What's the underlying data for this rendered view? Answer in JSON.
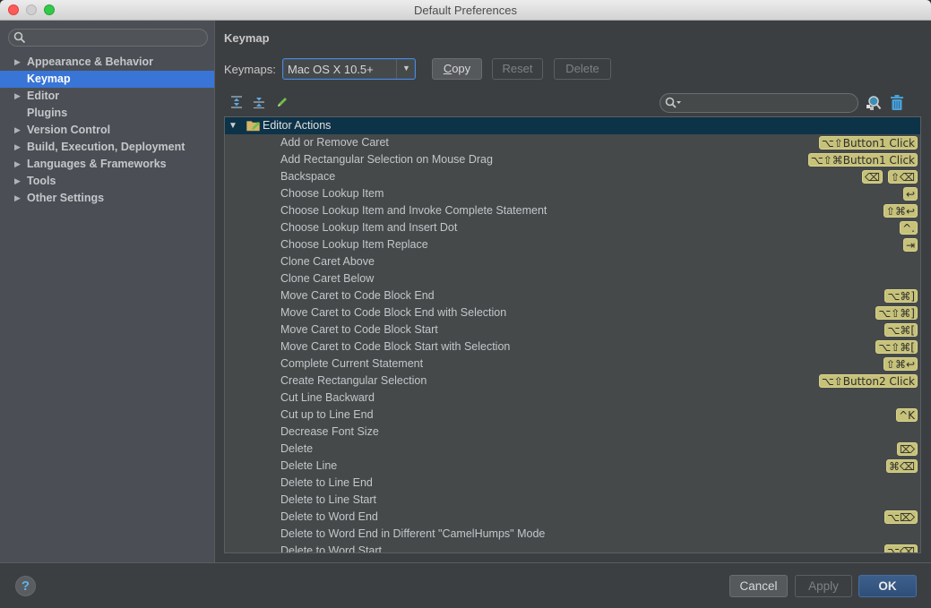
{
  "window": {
    "title": "Default Preferences"
  },
  "sidebar": {
    "search_placeholder": "",
    "items": [
      {
        "label": "Appearance & Behavior",
        "expandable": true,
        "selected": false
      },
      {
        "label": "Keymap",
        "expandable": false,
        "selected": true
      },
      {
        "label": "Editor",
        "expandable": true,
        "selected": false
      },
      {
        "label": "Plugins",
        "expandable": false,
        "selected": false
      },
      {
        "label": "Version Control",
        "expandable": true,
        "selected": false
      },
      {
        "label": "Build, Execution, Deployment",
        "expandable": true,
        "selected": false
      },
      {
        "label": "Languages & Frameworks",
        "expandable": true,
        "selected": false
      },
      {
        "label": "Tools",
        "expandable": true,
        "selected": false
      },
      {
        "label": "Other Settings",
        "expandable": true,
        "selected": false
      }
    ]
  },
  "main": {
    "heading": "Keymap",
    "keymaps_label": "Keymaps:",
    "keymap_selected": "Mac OS X 10.5+",
    "buttons": {
      "copy": "Copy",
      "reset": "Reset",
      "delete": "Delete"
    },
    "toolbar_icons": [
      "expand-all-icon",
      "collapse-all-icon",
      "edit-pencil-icon"
    ],
    "filter_value": "",
    "group": {
      "label": "Editor Actions",
      "expanded": true
    },
    "actions": [
      {
        "name": "Add or Remove Caret",
        "shortcuts": [
          "⌥⇧Button1 Click"
        ]
      },
      {
        "name": "Add Rectangular Selection on Mouse Drag",
        "shortcuts": [
          "⌥⇧⌘Button1 Click"
        ]
      },
      {
        "name": "Backspace",
        "shortcuts": [
          "⌫",
          "⇧⌫"
        ]
      },
      {
        "name": "Choose Lookup Item",
        "shortcuts": [
          "↩"
        ]
      },
      {
        "name": "Choose Lookup Item and Invoke Complete Statement",
        "shortcuts": [
          "⇧⌘↩"
        ]
      },
      {
        "name": "Choose Lookup Item and Insert Dot",
        "shortcuts": [
          "^."
        ]
      },
      {
        "name": "Choose Lookup Item Replace",
        "shortcuts": [
          "⇥"
        ]
      },
      {
        "name": "Clone Caret Above",
        "shortcuts": []
      },
      {
        "name": "Clone Caret Below",
        "shortcuts": []
      },
      {
        "name": "Move Caret to Code Block End",
        "shortcuts": [
          "⌥⌘]"
        ]
      },
      {
        "name": "Move Caret to Code Block End with Selection",
        "shortcuts": [
          "⌥⇧⌘]"
        ]
      },
      {
        "name": "Move Caret to Code Block Start",
        "shortcuts": [
          "⌥⌘["
        ]
      },
      {
        "name": "Move Caret to Code Block Start with Selection",
        "shortcuts": [
          "⌥⇧⌘["
        ]
      },
      {
        "name": "Complete Current Statement",
        "shortcuts": [
          "⇧⌘↩"
        ]
      },
      {
        "name": "Create Rectangular Selection",
        "shortcuts": [
          "⌥⇧Button2 Click"
        ]
      },
      {
        "name": "Cut Line Backward",
        "shortcuts": []
      },
      {
        "name": "Cut up to Line End",
        "shortcuts": [
          "^K"
        ]
      },
      {
        "name": "Decrease Font Size",
        "shortcuts": []
      },
      {
        "name": "Delete",
        "shortcuts": [
          "⌦"
        ]
      },
      {
        "name": "Delete Line",
        "shortcuts": [
          "⌘⌫"
        ]
      },
      {
        "name": "Delete to Line End",
        "shortcuts": []
      },
      {
        "name": "Delete to Line Start",
        "shortcuts": []
      },
      {
        "name": "Delete to Word End",
        "shortcuts": [
          "⌥⌦"
        ]
      },
      {
        "name": "Delete to Word End in Different \"CamelHumps\" Mode",
        "shortcuts": []
      },
      {
        "name": "Delete to Word Start",
        "shortcuts": [
          "⌥⌫"
        ]
      }
    ]
  },
  "footer": {
    "help": "?",
    "cancel": "Cancel",
    "apply": "Apply",
    "ok": "OK"
  },
  "colors": {
    "selection": "#3875d6",
    "group_row": "#0d3349",
    "shortcut_badge": "#c7c27a",
    "ok_button": "#2f4f78"
  }
}
